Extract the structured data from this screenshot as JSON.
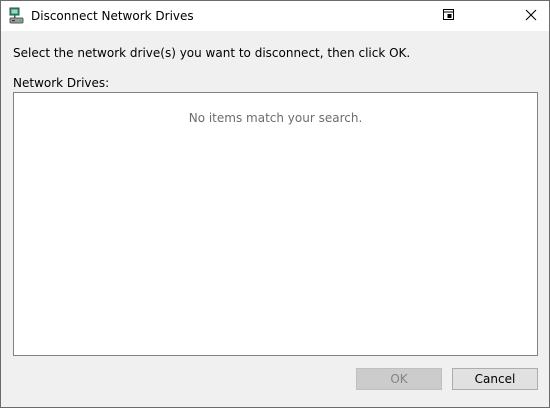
{
  "window": {
    "title": "Disconnect Network Drives",
    "icons": {
      "app": "network-drive-icon",
      "context_help": "context-help-icon",
      "close": "close-icon"
    }
  },
  "dialog": {
    "instruction": "Select the network drive(s) you want to disconnect, then click OK.",
    "list_label": "Network Drives:",
    "empty_message": "No items match your search."
  },
  "buttons": {
    "ok_label": "OK",
    "ok_enabled": false,
    "cancel_label": "Cancel"
  },
  "colors": {
    "titlebar_bg": "#ffffff",
    "dialog_bg": "#f0f0f0",
    "disabled_text": "#838383",
    "placeholder_text": "#6d6d6d"
  }
}
